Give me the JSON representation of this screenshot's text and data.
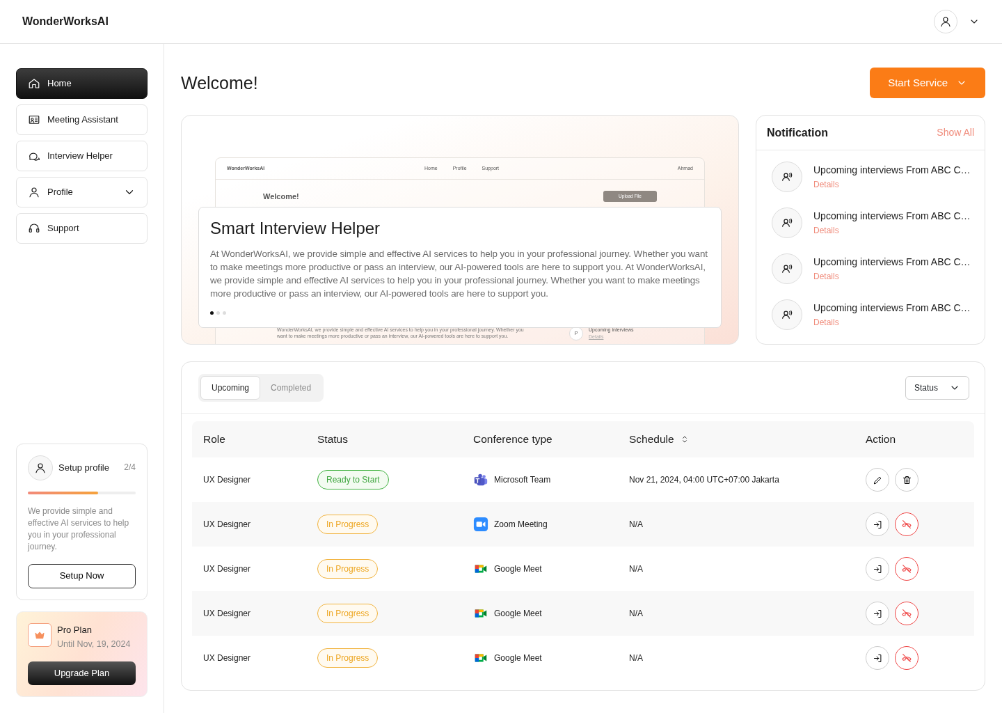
{
  "header": {
    "logo": "WonderWorksAI"
  },
  "sidebar": {
    "items": [
      {
        "label": "Home",
        "kind": "home",
        "selected": true
      },
      {
        "label": "Meeting Assistant",
        "kind": "meeting",
        "selected": false
      },
      {
        "label": "Interview Helper",
        "kind": "chat",
        "selected": false
      },
      {
        "label": "Profile",
        "kind": "user",
        "selected": false,
        "expanded": false
      },
      {
        "label": "Support",
        "kind": "headset",
        "selected": false
      }
    ],
    "setup": {
      "title": "Setup profile",
      "count": "2/4",
      "level": 0.65,
      "text": "We provide simple and effective AI services to help you in your professional journey.",
      "button": "Setup Now"
    },
    "plan": {
      "title": "Pro Plan",
      "until": "Until Nov, 19, 2024",
      "button": "Upgrade Plan"
    }
  },
  "page": {
    "title": "Welcome!",
    "start_button": "Start Service"
  },
  "hero": {
    "preview": {
      "logo": "WonderWorksAI",
      "nav": [
        "Home",
        "Profile",
        "Support"
      ],
      "user": "Ahmad",
      "title": "Welcome!",
      "button": "Upload File",
      "text": [
        "WonderWorksAI, we provide simple and effective AI services to help you in your professional journey. Whether you",
        "want to make meetings more productive or pass an interview, our AI-powered tools are here to support you."
      ],
      "avatar": "P",
      "notice": "Upcoming interviews",
      "notice_link": "Details"
    },
    "title": "Smart Interview Helper",
    "text": "At WonderWorksAI, we provide simple and effective AI services to help you in your professional journey. Whether you want to make meetings more productive or pass an interview, our AI-powered tools are here to support you. At WonderWorksAI, we provide simple and effective AI services to help you in your professional journey. Whether you want to make meetings more productive or pass an interview, our AI-powered tools are here to support you.",
    "dots": [
      {
        "selected": true
      },
      {
        "selected": false
      },
      {
        "selected": false
      }
    ]
  },
  "notifications": {
    "title": "Notification",
    "show_all": "Show All",
    "items": [
      {
        "text": "Upcoming interviews From ABC C…",
        "link": "Details"
      },
      {
        "text": "Upcoming interviews From ABC C…",
        "link": "Details"
      },
      {
        "text": "Upcoming interviews From ABC C…",
        "link": "Details"
      },
      {
        "text": "Upcoming interviews From ABC C…",
        "link": "Details"
      }
    ]
  },
  "table": {
    "tabs": [
      {
        "label": "Upcoming",
        "selected": true
      },
      {
        "label": "Completed",
        "selected": false
      }
    ],
    "filter": "Status",
    "columns": [
      {
        "label": "Role"
      },
      {
        "label": "Status"
      },
      {
        "label": "Conference type"
      },
      {
        "label": "Schedule",
        "sortable": true
      },
      {
        "label": "Action"
      }
    ],
    "rows": [
      {
        "kind": "editable",
        "role": "UX Designer",
        "status": {
          "text": "Ready to Start",
          "kind": "ready"
        },
        "conference": {
          "text": "Microsoft Team",
          "kind": "teams"
        },
        "schedule": "Nov 21, 2024, 04:00 UTC+07:00 Jakarta"
      },
      {
        "kind": "live",
        "role": "UX Designer",
        "status": {
          "text": "In Progress",
          "kind": "active"
        },
        "conference": {
          "text": "Zoom Meeting",
          "kind": "zoom"
        },
        "schedule": "N/A"
      },
      {
        "kind": "live",
        "role": "UX Designer",
        "status": {
          "text": "In Progress",
          "kind": "active"
        },
        "conference": {
          "text": "Google Meet",
          "kind": "meet"
        },
        "schedule": "N/A"
      },
      {
        "kind": "live",
        "role": "UX Designer",
        "status": {
          "text": "In Progress",
          "kind": "active"
        },
        "conference": {
          "text": "Google Meet",
          "kind": "meet"
        },
        "schedule": "N/A"
      },
      {
        "kind": "live",
        "role": "UX Designer",
        "status": {
          "text": "In Progress",
          "kind": "active"
        },
        "conference": {
          "text": "Google Meet",
          "kind": "meet"
        },
        "schedule": "N/A"
      }
    ]
  }
}
